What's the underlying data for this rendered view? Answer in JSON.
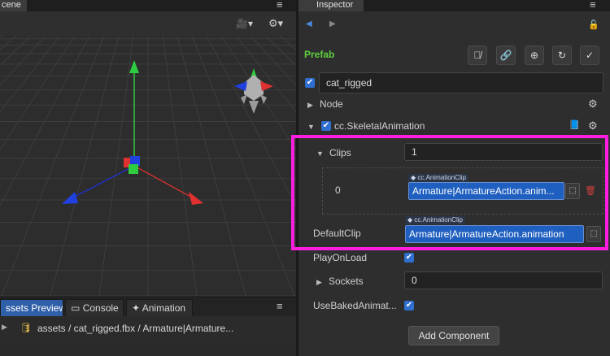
{
  "scene": {
    "tab_label": "cene",
    "menu_glyph": "≡",
    "camera_dropdown_glyph": "🎥▾",
    "settings_dropdown_glyph": "⚙▾"
  },
  "bottom_panel": {
    "tabs": [
      {
        "label": "ssets Preview",
        "icon": ""
      },
      {
        "label": "Console",
        "icon": "▭"
      },
      {
        "label": "Animation",
        "icon": "✦"
      }
    ],
    "menu_glyph": "≡",
    "asset_path": "assets / cat_rigged.fbx / Armature|Armature..."
  },
  "inspector": {
    "tab_label": "Inspector",
    "menu_glyph": "≡",
    "nav_back_glyph": "◀",
    "nav_forward_glyph": "▶",
    "lock_glyph": "🔓",
    "prefab_label": "Prefab",
    "prefab_color": "#5fcf3f",
    "prefab_buttons": [
      "⛓̸",
      "🔗",
      "⊕",
      "↻",
      "✓"
    ],
    "node_name": "cat_rigged",
    "node_section_label": "Node",
    "component_label": "cc.SkeletalAnimation",
    "clips_label": "Clips",
    "clips_count": "1",
    "clip_index_label": "0",
    "clip_tag": "◆ cc.AnimationClip",
    "clip_value": "Armature|ArmatureAction.anim...",
    "default_clip_label": "DefaultClip",
    "default_clip_tag": "◆ cc.AnimationClip",
    "default_clip_value": "Armature|ArmatureAction.animation",
    "play_on_load_label": "PlayOnLoad",
    "sockets_label": "Sockets",
    "sockets_count": "0",
    "use_baked_label": "UseBakedAnimat...",
    "add_component_label": "Add Component",
    "check_glyph": "✔",
    "gear_glyph": "⚙",
    "book_glyph": "📘",
    "trash_glyph": "🗑",
    "pick_glyph": "⬚"
  },
  "colors": {
    "accent_blue": "#2f6fd0",
    "highlight": "#ff1ee0"
  }
}
